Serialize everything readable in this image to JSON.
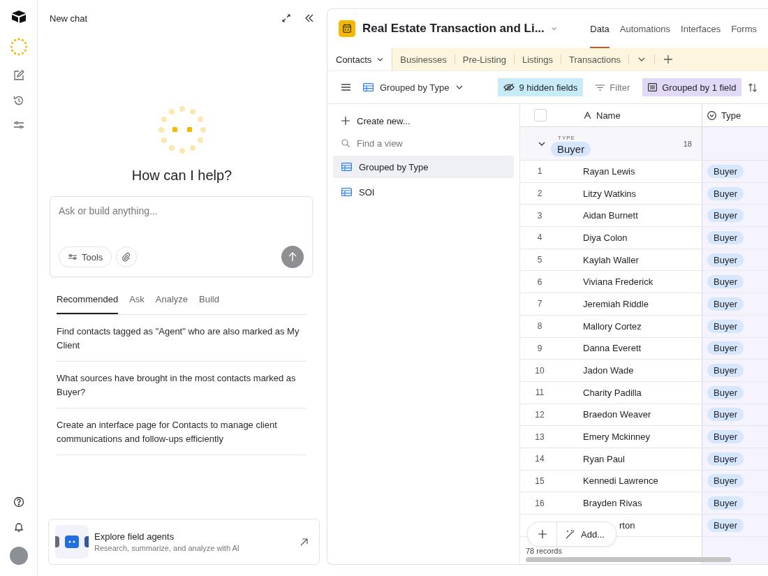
{
  "chat": {
    "title": "New chat",
    "heading": "How can I help?",
    "placeholder": "Ask or build anything...",
    "tools": "Tools",
    "tabs": [
      {
        "label": "Recommended",
        "selected": true
      },
      {
        "label": "Ask",
        "selected": false
      },
      {
        "label": "Analyze",
        "selected": false
      },
      {
        "label": "Build",
        "selected": false
      }
    ],
    "suggestions": [
      "Find contacts tagged as \"Agent\" who are also marked as My Client",
      "What sources have brought in the most contacts marked as Buyer?",
      "Create an interface page for Contacts to manage client communications and follow-ups efficiently"
    ],
    "promo": {
      "title": "Explore field agents",
      "subtitle": "Research, summarize, and analyze with AI"
    }
  },
  "base": {
    "title": "Real Estate Transaction and Li...",
    "nav": [
      {
        "label": "Data",
        "selected": true
      },
      {
        "label": "Automations",
        "selected": false
      },
      {
        "label": "Interfaces",
        "selected": false
      },
      {
        "label": "Forms",
        "selected": false
      }
    ],
    "tables": [
      {
        "label": "Contacts",
        "selected": true
      },
      {
        "label": "Businesses",
        "selected": false
      },
      {
        "label": "Pre-Listing",
        "selected": false
      },
      {
        "label": "Listings",
        "selected": false
      },
      {
        "label": "Transactions",
        "selected": false
      }
    ],
    "toolbar": {
      "view": "Grouped by Type",
      "hidden": "9 hidden fields",
      "filter": "Filter",
      "group": "Grouped by 1 field"
    },
    "sidebar": {
      "create": "Create new...",
      "search_placeholder": "Find a view",
      "views": [
        {
          "name": "Grouped by Type",
          "selected": true
        },
        {
          "name": "SOI",
          "selected": false
        }
      ]
    },
    "grid": {
      "select_all_checked": false,
      "columns": [
        "Name",
        "Type"
      ],
      "group": {
        "label": "TYPE",
        "value": "Buyer",
        "count": "18",
        "expanded": true
      },
      "rows": [
        {
          "number": "1",
          "name": "Rayan Lewis",
          "type": "Buyer"
        },
        {
          "number": "2",
          "name": "Litzy Watkins",
          "type": "Buyer"
        },
        {
          "number": "3",
          "name": "Aidan Burnett",
          "type": "Buyer"
        },
        {
          "number": "4",
          "name": "Diya Colon",
          "type": "Buyer"
        },
        {
          "number": "5",
          "name": "Kaylah Waller",
          "type": "Buyer"
        },
        {
          "number": "6",
          "name": "Viviana Frederick",
          "type": "Buyer"
        },
        {
          "number": "7",
          "name": "Jeremiah Riddle",
          "type": "Buyer"
        },
        {
          "number": "8",
          "name": "Mallory Cortez",
          "type": "Buyer"
        },
        {
          "number": "9",
          "name": "Danna Everett",
          "type": "Buyer"
        },
        {
          "number": "10",
          "name": "Jadon Wade",
          "type": "Buyer"
        },
        {
          "number": "11",
          "name": "Charity Padilla",
          "type": "Buyer"
        },
        {
          "number": "12",
          "name": "Braedon Weaver",
          "type": "Buyer"
        },
        {
          "number": "13",
          "name": "Emery Mckinney",
          "type": "Buyer"
        },
        {
          "number": "14",
          "name": "Ryan Paul",
          "type": "Buyer"
        },
        {
          "number": "15",
          "name": "Kennedi Lawrence",
          "type": "Buyer"
        },
        {
          "number": "16",
          "name": "Brayden Rivas",
          "type": "Buyer"
        },
        {
          "name": "rton",
          "type": "Buyer"
        }
      ],
      "add": "Add...",
      "footer": "78 records"
    }
  }
}
